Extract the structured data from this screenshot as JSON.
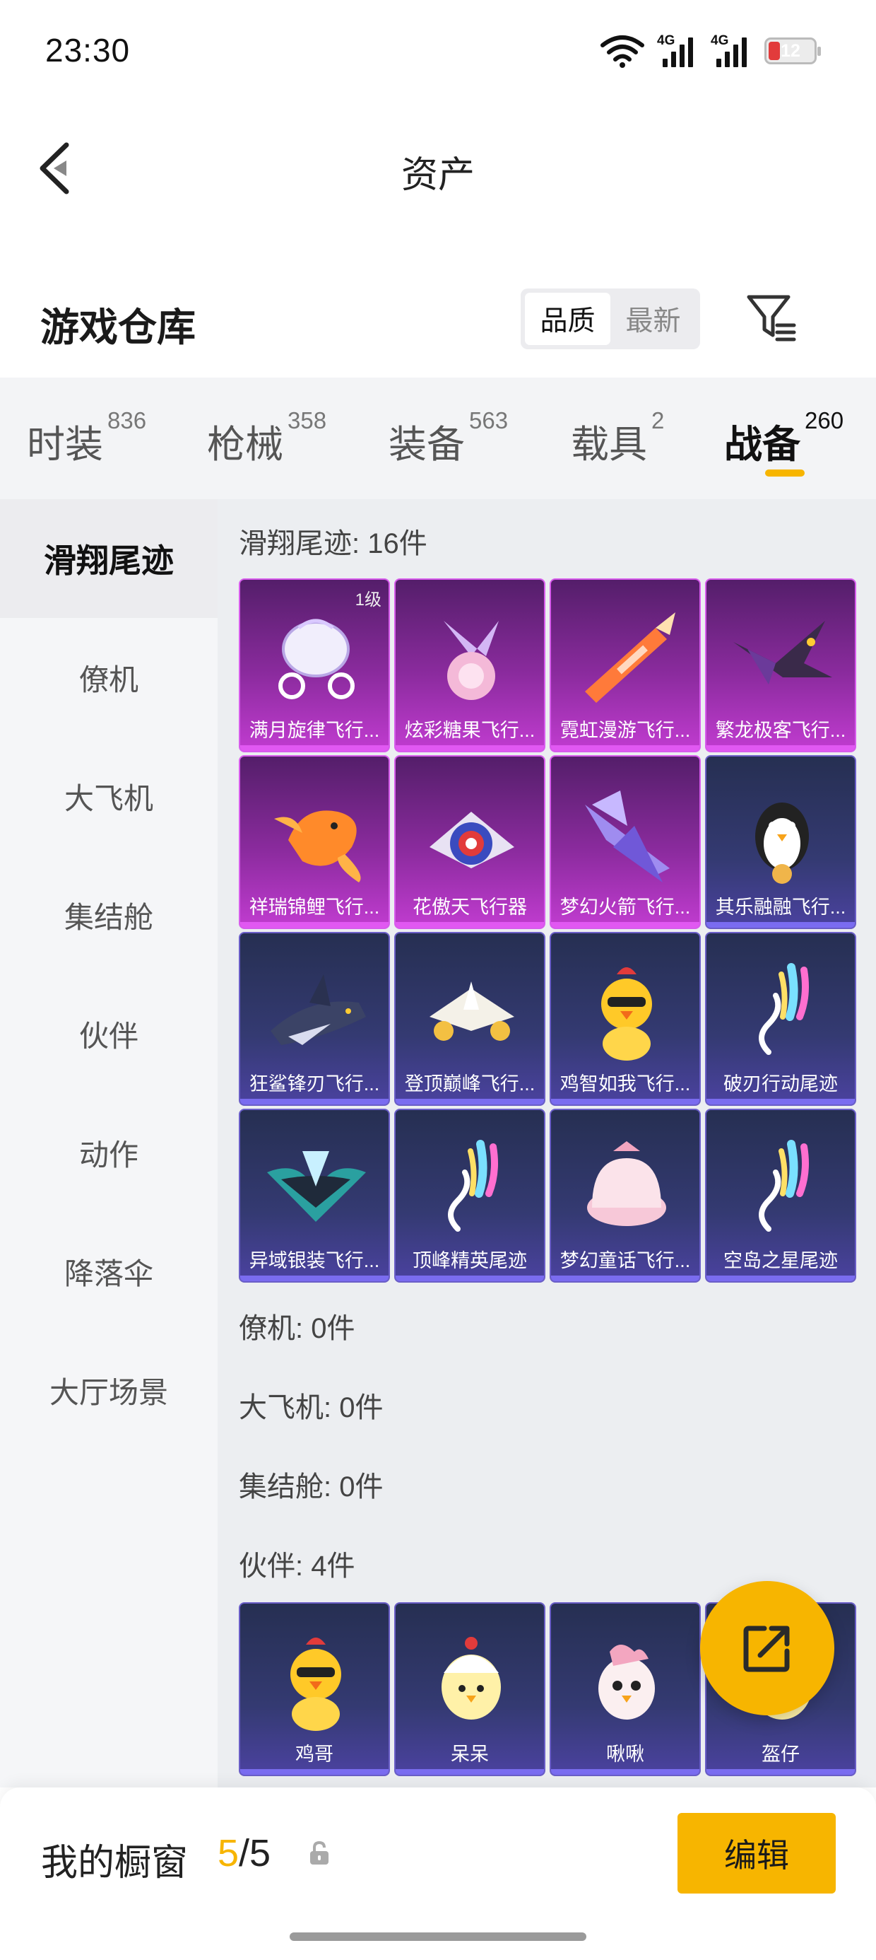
{
  "status_bar": {
    "time": "23:30",
    "network1": "4G",
    "network2": "4G",
    "battery": "12"
  },
  "nav": {
    "back_icon": "chevron-left-icon",
    "title": "资产"
  },
  "header": {
    "section_title": "游戏仓库",
    "sort": [
      "品质",
      "最新"
    ],
    "sort_active": 0,
    "filter_icon": "filter-icon"
  },
  "categories": [
    {
      "label": "时装",
      "count": "836"
    },
    {
      "label": "枪械",
      "count": "358"
    },
    {
      "label": "装备",
      "count": "563"
    },
    {
      "label": "载具",
      "count": "2"
    },
    {
      "label": "战备",
      "count": "260"
    }
  ],
  "category_active": 4,
  "sidebar": {
    "items": [
      "滑翔尾迹",
      "僚机",
      "大飞机",
      "集结舱",
      "伙伴",
      "动作",
      "降落伞",
      "大厅场景"
    ],
    "active": 0
  },
  "groups": {
    "glide": {
      "label": "滑翔尾迹: 16件",
      "items": [
        {
          "name": "满月旋律飞行...",
          "tier": "purple",
          "level": "1级",
          "art": "carriage-icon"
        },
        {
          "name": "炫彩糖果飞行...",
          "tier": "purple",
          "art": "candy-icon"
        },
        {
          "name": "霓虹漫游飞行...",
          "tier": "purple",
          "art": "rocket-icon"
        },
        {
          "name": "繁龙极客飞行...",
          "tier": "purple",
          "art": "dragon-icon"
        },
        {
          "name": "祥瑞锦鲤飞行...",
          "tier": "purple",
          "art": "koi-icon"
        },
        {
          "name": "花傲天飞行器",
          "tier": "purple",
          "art": "shield-jet-icon"
        },
        {
          "name": "梦幻火箭飞行...",
          "tier": "purple",
          "art": "wing-jet-icon"
        },
        {
          "name": "其乐融融飞行...",
          "tier": "navy",
          "art": "penguin-icon"
        },
        {
          "name": "狂鲨锋刃飞行...",
          "tier": "navy",
          "art": "shark-icon"
        },
        {
          "name": "登顶巅峰飞行...",
          "tier": "navy",
          "art": "glider-icon"
        },
        {
          "name": "鸡智如我飞行...",
          "tier": "navy",
          "art": "chicken-icon"
        },
        {
          "name": "破刃行动尾迹",
          "tier": "navy",
          "art": "smoke-trail-icon"
        },
        {
          "name": "异域银装飞行...",
          "tier": "navy",
          "art": "silver-wing-icon"
        },
        {
          "name": "顶峰精英尾迹",
          "tier": "navy",
          "art": "smoke-trail-icon"
        },
        {
          "name": "梦幻童话飞行...",
          "tier": "navy",
          "art": "pink-bed-icon"
        },
        {
          "name": "空岛之星尾迹",
          "tier": "navy",
          "art": "smoke-trail-icon"
        }
      ]
    },
    "wingman": {
      "label": "僚机: 0件"
    },
    "aircraft": {
      "label": "大飞机: 0件"
    },
    "pod": {
      "label": "集结舱: 0件"
    },
    "partner": {
      "label": "伙伴: 4件",
      "items": [
        {
          "name": "鸡哥",
          "tier": "navy",
          "art": "chicken-icon"
        },
        {
          "name": "呆呆",
          "tier": "navy",
          "art": "chick-icon"
        },
        {
          "name": "啾啾",
          "tier": "navy",
          "art": "bird-icon"
        },
        {
          "name": "盔仔",
          "tier": "navy",
          "art": "chick-icon"
        }
      ]
    }
  },
  "fab_icon": "share-out-icon",
  "bottom_bar": {
    "label": "我的橱窗",
    "count_current": "5",
    "count_total": "/5",
    "lock_icon": "lock-icon",
    "edit_label": "编辑"
  },
  "colors": {
    "accent": "#f7b500",
    "purple_tier": "#c13cd0",
    "navy_tier": "#4b42a0"
  }
}
